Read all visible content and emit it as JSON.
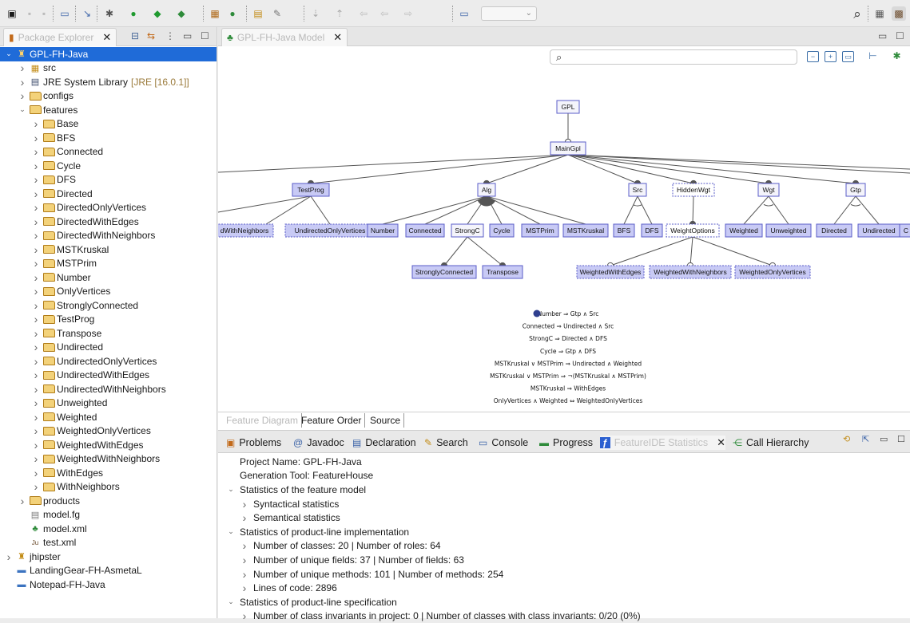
{
  "explorer": {
    "title": "Package Explorer",
    "tree": [
      {
        "label": "GPL-FH-Java",
        "indent": 0,
        "twisty": "open",
        "icon": "project-icon",
        "selected": true
      },
      {
        "label": "src",
        "indent": 1,
        "twisty": "closed",
        "icon": "source-folder-icon"
      },
      {
        "label": "JRE System Library",
        "suffix": "[JRE [16.0.1]]",
        "indent": 1,
        "twisty": "closed",
        "icon": "library-icon"
      },
      {
        "label": "configs",
        "indent": 1,
        "twisty": "closed",
        "icon": "folder-icon"
      },
      {
        "label": "features",
        "indent": 1,
        "twisty": "open",
        "icon": "folder-icon"
      },
      {
        "label": "Base",
        "indent": 2,
        "twisty": "closed",
        "icon": "folder-icon"
      },
      {
        "label": "BFS",
        "indent": 2,
        "twisty": "closed",
        "icon": "folder-icon"
      },
      {
        "label": "Connected",
        "indent": 2,
        "twisty": "closed",
        "icon": "folder-icon"
      },
      {
        "label": "Cycle",
        "indent": 2,
        "twisty": "closed",
        "icon": "folder-icon"
      },
      {
        "label": "DFS",
        "indent": 2,
        "twisty": "closed",
        "icon": "folder-icon"
      },
      {
        "label": "Directed",
        "indent": 2,
        "twisty": "closed",
        "icon": "folder-icon"
      },
      {
        "label": "DirectedOnlyVertices",
        "indent": 2,
        "twisty": "closed",
        "icon": "folder-icon"
      },
      {
        "label": "DirectedWithEdges",
        "indent": 2,
        "twisty": "closed",
        "icon": "folder-icon"
      },
      {
        "label": "DirectedWithNeighbors",
        "indent": 2,
        "twisty": "closed",
        "icon": "folder-icon"
      },
      {
        "label": "MSTKruskal",
        "indent": 2,
        "twisty": "closed",
        "icon": "folder-icon"
      },
      {
        "label": "MSTPrim",
        "indent": 2,
        "twisty": "closed",
        "icon": "folder-icon"
      },
      {
        "label": "Number",
        "indent": 2,
        "twisty": "closed",
        "icon": "folder-icon"
      },
      {
        "label": "OnlyVertices",
        "indent": 2,
        "twisty": "closed",
        "icon": "folder-icon"
      },
      {
        "label": "StronglyConnected",
        "indent": 2,
        "twisty": "closed",
        "icon": "folder-icon"
      },
      {
        "label": "TestProg",
        "indent": 2,
        "twisty": "closed",
        "icon": "folder-icon"
      },
      {
        "label": "Transpose",
        "indent": 2,
        "twisty": "closed",
        "icon": "folder-icon"
      },
      {
        "label": "Undirected",
        "indent": 2,
        "twisty": "closed",
        "icon": "folder-icon"
      },
      {
        "label": "UndirectedOnlyVertices",
        "indent": 2,
        "twisty": "closed",
        "icon": "folder-icon"
      },
      {
        "label": "UndirectedWithEdges",
        "indent": 2,
        "twisty": "closed",
        "icon": "folder-icon"
      },
      {
        "label": "UndirectedWithNeighbors",
        "indent": 2,
        "twisty": "closed",
        "icon": "folder-icon"
      },
      {
        "label": "Unweighted",
        "indent": 2,
        "twisty": "closed",
        "icon": "folder-icon"
      },
      {
        "label": "Weighted",
        "indent": 2,
        "twisty": "closed",
        "icon": "folder-icon"
      },
      {
        "label": "WeightedOnlyVertices",
        "indent": 2,
        "twisty": "closed",
        "icon": "folder-icon"
      },
      {
        "label": "WeightedWithEdges",
        "indent": 2,
        "twisty": "closed",
        "icon": "folder-icon"
      },
      {
        "label": "WeightedWithNeighbors",
        "indent": 2,
        "twisty": "closed",
        "icon": "folder-icon"
      },
      {
        "label": "WithEdges",
        "indent": 2,
        "twisty": "closed",
        "icon": "folder-icon"
      },
      {
        "label": "WithNeighbors",
        "indent": 2,
        "twisty": "closed",
        "icon": "folder-icon"
      },
      {
        "label": "products",
        "indent": 1,
        "twisty": "closed",
        "icon": "folder-icon"
      },
      {
        "label": "model.fg",
        "indent": 1,
        "twisty": "none",
        "icon": "file-icon"
      },
      {
        "label": "model.xml",
        "indent": 1,
        "twisty": "none",
        "icon": "feature-model-icon"
      },
      {
        "label": "test.xml",
        "indent": 1,
        "twisty": "none",
        "icon": "junit-file-icon"
      },
      {
        "label": "jhipster",
        "indent": 0,
        "twisty": "closed",
        "icon": "project-icon"
      },
      {
        "label": "LandingGear-FH-AsmetaL",
        "indent": 0,
        "twisty": "none",
        "icon": "closed-project-icon"
      },
      {
        "label": "Notepad-FH-Java",
        "indent": 0,
        "twisty": "none",
        "icon": "closed-project-icon"
      }
    ]
  },
  "editor": {
    "tab_title": "GPL-FH-Java Model",
    "bottom_tabs": [
      "Feature Diagram",
      "Feature Order",
      "Source"
    ],
    "features": [
      {
        "id": "gpl",
        "label": "GPL",
        "style": "abstract"
      },
      {
        "id": "maingpl",
        "label": "MainGpl",
        "style": "abstract"
      },
      {
        "id": "testprog",
        "label": "TestProg",
        "style": "concrete"
      },
      {
        "id": "alg",
        "label": "Alg",
        "style": "abstract"
      },
      {
        "id": "src",
        "label": "Src",
        "style": "abstract"
      },
      {
        "id": "hiddenwgt",
        "label": "HiddenWgt",
        "style": "hidden"
      },
      {
        "id": "wgt",
        "label": "Wgt",
        "style": "abstract"
      },
      {
        "id": "gtp",
        "label": "Gtp",
        "style": "abstract"
      },
      {
        "id": "dwn",
        "label": "dWithNeighbors",
        "style": "hidden"
      },
      {
        "id": "uov",
        "label": "UndirectedOnlyVertices",
        "style": "hidden"
      },
      {
        "id": "number",
        "label": "Number",
        "style": "concrete"
      },
      {
        "id": "connected",
        "label": "Connected",
        "style": "concrete"
      },
      {
        "id": "strongc",
        "label": "StrongC",
        "style": "abstract"
      },
      {
        "id": "cycle",
        "label": "Cycle",
        "style": "concrete"
      },
      {
        "id": "mstprim",
        "label": "MSTPrim",
        "style": "concrete"
      },
      {
        "id": "mstkruskal",
        "label": "MSTKruskal",
        "style": "concrete"
      },
      {
        "id": "bfs",
        "label": "BFS",
        "style": "concrete"
      },
      {
        "id": "dfs",
        "label": "DFS",
        "style": "concrete"
      },
      {
        "id": "weightoptions",
        "label": "WeightOptions",
        "style": "hidden"
      },
      {
        "id": "weighted",
        "label": "Weighted",
        "style": "concrete"
      },
      {
        "id": "unweighted",
        "label": "Unweighted",
        "style": "concrete"
      },
      {
        "id": "directed",
        "label": "Directed",
        "style": "concrete"
      },
      {
        "id": "undirected",
        "label": "Undirected",
        "style": "concrete"
      },
      {
        "id": "cut",
        "label": "C",
        "style": "concrete"
      },
      {
        "id": "stronglyconnected",
        "label": "StronglyConnected",
        "style": "concrete"
      },
      {
        "id": "transpose",
        "label": "Transpose",
        "style": "concrete"
      },
      {
        "id": "wwe",
        "label": "WeightedWithEdges",
        "style": "hidden"
      },
      {
        "id": "wwn",
        "label": "WeightedWithNeighbors",
        "style": "hidden"
      },
      {
        "id": "wov",
        "label": "WeightedOnlyVertices",
        "style": "hidden"
      }
    ],
    "constraints": [
      "Number ⇒ Gtp ∧ Src",
      "Connected ⇒ Undirected ∧ Src",
      "StrongC ⇒ Directed ∧ DFS",
      "Cycle ⇒ Gtp ∧ DFS",
      "MSTKruskal ∨ MSTPrim ⇒ Undirected ∧ Weighted",
      "MSTKruskal ∨ MSTPrim ⇒ ¬(MSTKruskal ∧ MSTPrim)",
      "MSTKruskal ⇒ WithEdges",
      "OnlyVertices ∧ Weighted ⇔ WeightedOnlyVertices"
    ]
  },
  "stats_view": {
    "tabs": [
      {
        "label": "Problems",
        "icon": "problems-icon"
      },
      {
        "label": "Javadoc",
        "icon": "javadoc-icon"
      },
      {
        "label": "Declaration",
        "icon": "declaration-icon"
      },
      {
        "label": "Search",
        "icon": "search-icon"
      },
      {
        "label": "Console",
        "icon": "console-icon"
      },
      {
        "label": "Progress",
        "icon": "progress-icon"
      },
      {
        "label": "FeatureIDE Statistics",
        "icon": "featureide-icon",
        "active": true
      },
      {
        "label": "Call Hierarchy",
        "icon": "call-hierarchy-icon"
      }
    ],
    "rows": [
      {
        "text": "Project Name: GPL-FH-Java",
        "indent": 0,
        "twisty": "none"
      },
      {
        "text": "Generation Tool: FeatureHouse",
        "indent": 0,
        "twisty": "none"
      },
      {
        "text": "Statistics of the feature model",
        "indent": 0,
        "twisty": "open"
      },
      {
        "text": "Syntactical statistics",
        "indent": 1,
        "twisty": "closed"
      },
      {
        "text": "Semantical statistics",
        "indent": 1,
        "twisty": "closed"
      },
      {
        "text": "Statistics of product-line implementation",
        "indent": 0,
        "twisty": "open"
      },
      {
        "text": "Number of classes: 20 | Number of roles: 64",
        "indent": 1,
        "twisty": "closed"
      },
      {
        "text": "Number of unique fields: 37 | Number of fields: 63",
        "indent": 1,
        "twisty": "closed"
      },
      {
        "text": "Number of unique methods: 101 | Number of methods: 254",
        "indent": 1,
        "twisty": "closed"
      },
      {
        "text": "Lines of code: 2896",
        "indent": 1,
        "twisty": "closed"
      },
      {
        "text": "Statistics of product-line specification",
        "indent": 0,
        "twisty": "open"
      },
      {
        "text": "Number of class invariants in project: 0 | Number of classes with class invariants: 0/20 (0%)",
        "indent": 1,
        "twisty": "closed"
      }
    ]
  },
  "colors": {
    "selection": "#1f6bd8",
    "concrete_fill": "#c8caf5",
    "abstract_fill": "#f4f4fb",
    "feature_border": "#5a5cc8",
    "hidden_text": "#6b6bd0"
  }
}
